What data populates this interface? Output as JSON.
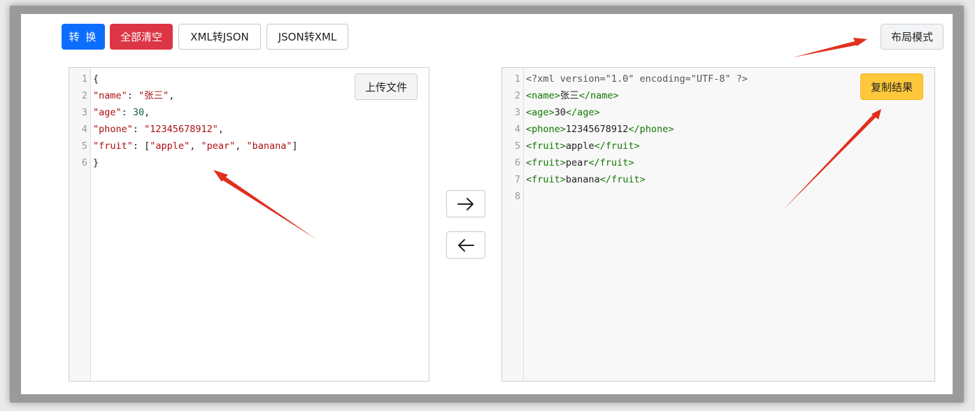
{
  "toolbar": {
    "convert_label": "转 换",
    "clear_label": "全部清空",
    "xml_to_json_label": "XML转JSON",
    "json_to_xml_label": "JSON转XML",
    "layout_mode_label": "布局模式"
  },
  "left_editor": {
    "upload_label": "上传文件",
    "line_numbers": [
      "1",
      "2",
      "3",
      "4",
      "5",
      "6"
    ],
    "lines": [
      [
        {
          "t": "{",
          "c": "plain"
        }
      ],
      [
        {
          "t": "\"name\"",
          "c": "key"
        },
        {
          "t": ": ",
          "c": "plain"
        },
        {
          "t": "\"张三\"",
          "c": "str"
        },
        {
          "t": ",",
          "c": "plain"
        }
      ],
      [
        {
          "t": "\"age\"",
          "c": "key"
        },
        {
          "t": ": ",
          "c": "plain"
        },
        {
          "t": "30",
          "c": "num"
        },
        {
          "t": ",",
          "c": "plain"
        }
      ],
      [
        {
          "t": "\"phone\"",
          "c": "key"
        },
        {
          "t": ": ",
          "c": "plain"
        },
        {
          "t": "\"12345678912\"",
          "c": "str"
        },
        {
          "t": ",",
          "c": "plain"
        }
      ],
      [
        {
          "t": "\"fruit\"",
          "c": "key"
        },
        {
          "t": ": [",
          "c": "plain"
        },
        {
          "t": "\"apple\"",
          "c": "str"
        },
        {
          "t": ", ",
          "c": "plain"
        },
        {
          "t": "\"pear\"",
          "c": "str"
        },
        {
          "t": ", ",
          "c": "plain"
        },
        {
          "t": "\"banana\"",
          "c": "str"
        },
        {
          "t": "]",
          "c": "plain"
        }
      ],
      [
        {
          "t": "}",
          "c": "plain"
        }
      ]
    ]
  },
  "right_editor": {
    "copy_label": "复制结果",
    "line_numbers": [
      "1",
      "2",
      "3",
      "4",
      "5",
      "6",
      "7",
      "8"
    ],
    "lines": [
      [
        {
          "t": "<?xml version=\"1.0\" encoding=\"UTF-8\" ?>",
          "c": "decl"
        }
      ],
      [
        {
          "t": "<name>",
          "c": "tag"
        },
        {
          "t": "张三",
          "c": "plain"
        },
        {
          "t": "</name>",
          "c": "tag"
        }
      ],
      [
        {
          "t": "<age>",
          "c": "tag"
        },
        {
          "t": "30",
          "c": "plain"
        },
        {
          "t": "</age>",
          "c": "tag"
        }
      ],
      [
        {
          "t": "<phone>",
          "c": "tag"
        },
        {
          "t": "12345678912",
          "c": "plain"
        },
        {
          "t": "</phone>",
          "c": "tag"
        }
      ],
      [
        {
          "t": "<fruit>",
          "c": "tag"
        },
        {
          "t": "apple",
          "c": "plain"
        },
        {
          "t": "</fruit>",
          "c": "tag"
        }
      ],
      [
        {
          "t": "<fruit>",
          "c": "tag"
        },
        {
          "t": "pear",
          "c": "plain"
        },
        {
          "t": "</fruit>",
          "c": "tag"
        }
      ],
      [
        {
          "t": "<fruit>",
          "c": "tag"
        },
        {
          "t": "banana",
          "c": "plain"
        },
        {
          "t": "</fruit>",
          "c": "tag"
        }
      ],
      []
    ]
  },
  "direction_buttons": {
    "to_right_icon": "arrow-right-icon",
    "to_left_icon": "arrow-left-icon"
  },
  "colors": {
    "primary": "#0d6efd",
    "danger": "#dc3545",
    "warning": "#ffc83a",
    "annotation_arrow": "#e0301e"
  }
}
